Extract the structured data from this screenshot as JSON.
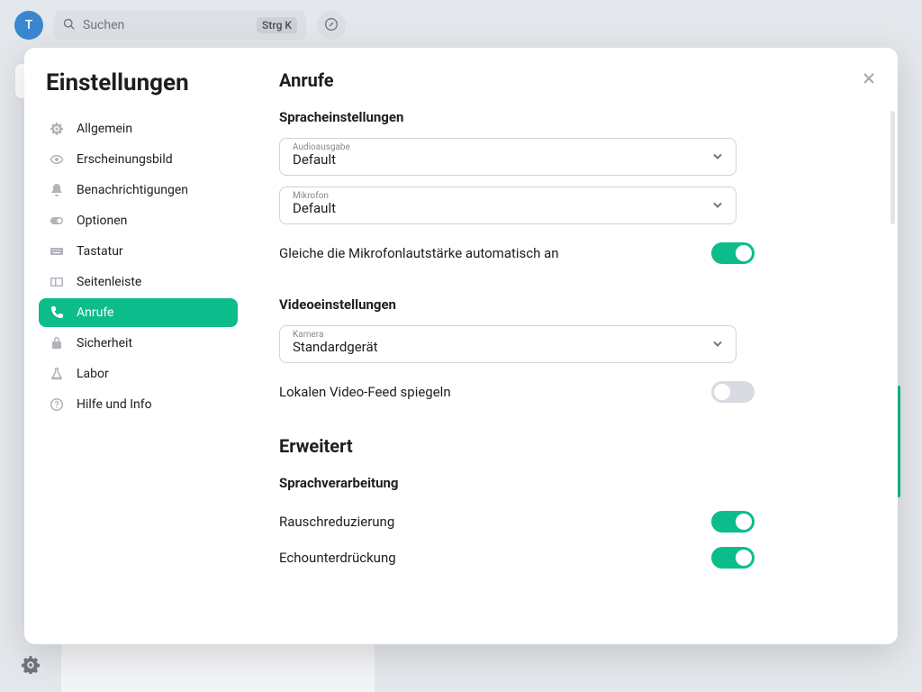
{
  "avatar_initial": "T",
  "search": {
    "placeholder": "Suchen",
    "shortcut": "Strg K"
  },
  "modal": {
    "title": "Einstellungen"
  },
  "sidebar": {
    "items": [
      {
        "label": "Allgemein",
        "icon": "settings-icon"
      },
      {
        "label": "Erscheinungsbild",
        "icon": "eye-icon"
      },
      {
        "label": "Benachrichtigungen",
        "icon": "bell-icon"
      },
      {
        "label": "Optionen",
        "icon": "toggle-icon"
      },
      {
        "label": "Tastatur",
        "icon": "keyboard-icon"
      },
      {
        "label": "Seitenleiste",
        "icon": "sidebar-icon"
      },
      {
        "label": "Anrufe",
        "icon": "phone-icon"
      },
      {
        "label": "Sicherheit",
        "icon": "lock-icon"
      },
      {
        "label": "Labor",
        "icon": "flask-icon"
      },
      {
        "label": "Hilfe und Info",
        "icon": "help-icon"
      }
    ]
  },
  "content": {
    "title": "Anrufe",
    "voice": {
      "heading": "Spracheinstellungen",
      "audio_out_label": "Audioausgabe",
      "audio_out_value": "Default",
      "mic_label": "Mikrofon",
      "mic_value": "Default",
      "auto_gain_label": "Gleiche die Mikrofonlautstärke automatisch an"
    },
    "video": {
      "heading": "Videoeinstellungen",
      "camera_label": "Kamera",
      "camera_value": "Standardgerät",
      "mirror_label": "Lokalen Video-Feed spiegeln"
    },
    "advanced": {
      "heading": "Erweitert",
      "processing_heading": "Sprachverarbeitung",
      "noise_label": "Rauschreduzierung",
      "echo_label": "Echounterdrückung"
    }
  }
}
